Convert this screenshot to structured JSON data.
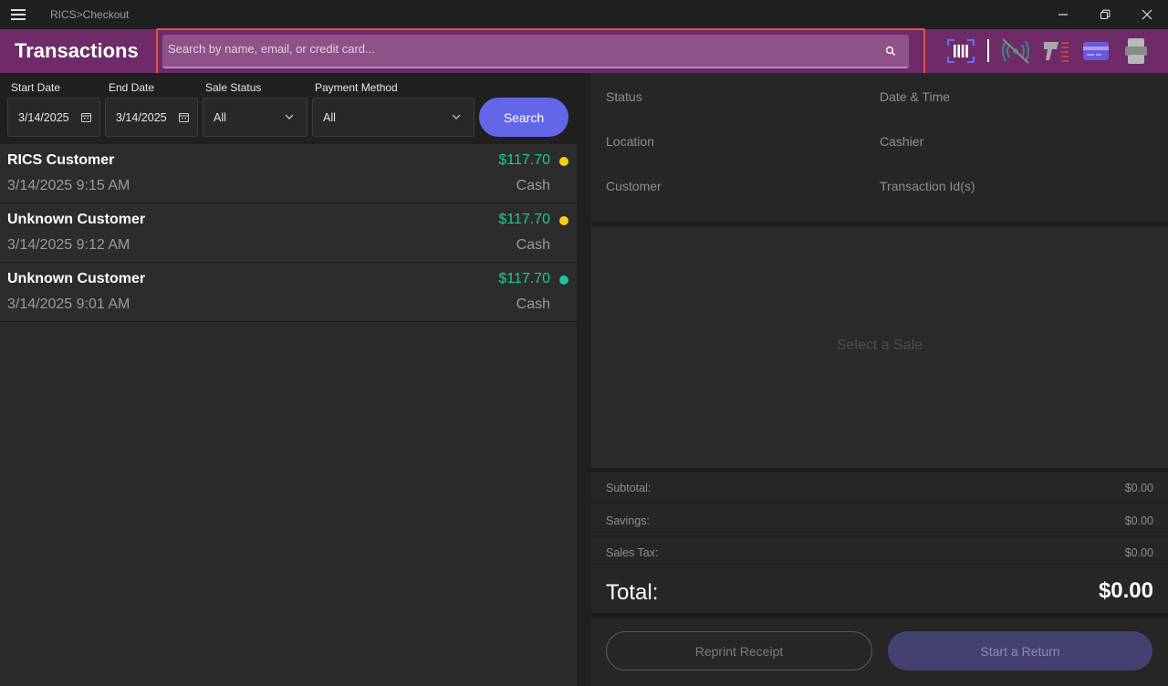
{
  "window": {
    "title": "RICS>Checkout",
    "minimize_icon": "minimize-icon",
    "restore_icon": "restore-icon",
    "close_icon": "close-icon"
  },
  "header": {
    "title": "Transactions",
    "search_placeholder": "Search by name, email, or credit card...",
    "search_value": "",
    "hardware_icons": [
      "barcode-scanner-icon",
      "nfc-disabled-icon",
      "handheld-scanner-icon",
      "card-reader-icon",
      "receipt-printer-icon"
    ]
  },
  "filters": {
    "start_date_label": "Start Date",
    "start_date": "3/14/2025",
    "end_date_label": "End Date",
    "end_date": "3/14/2025",
    "sale_status_label": "Sale Status",
    "sale_status": "All",
    "payment_method_label": "Payment Method",
    "payment_method": "All",
    "search_button": "Search"
  },
  "transactions": [
    {
      "name": "RICS Customer",
      "datetime": "3/14/2025 9:15 AM",
      "amount": "$117.70",
      "method": "Cash",
      "status_color": "#f5d016"
    },
    {
      "name": "Unknown Customer",
      "datetime": "3/14/2025 9:12 AM",
      "amount": "$117.70",
      "method": "Cash",
      "status_color": "#f5d016"
    },
    {
      "name": "Unknown Customer",
      "datetime": "3/14/2025 9:01 AM",
      "amount": "$117.70",
      "method": "Cash",
      "status_color": "#1fc49a"
    }
  ],
  "details": {
    "status_label": "Status",
    "datetime_label": "Date & Time",
    "location_label": "Location",
    "cashier_label": "Cashier",
    "customer_label": "Customer",
    "transaction_id_label": "Transaction Id(s)",
    "empty_message": "Select a Sale"
  },
  "totals": {
    "subtotal_label": "Subtotal:",
    "subtotal": "$0.00",
    "savings_label": "Savings:",
    "savings": "$0.00",
    "tax_label": "Sales Tax:",
    "tax": "$0.00",
    "total_label": "Total:",
    "total": "$0.00"
  },
  "actions": {
    "reprint": "Reprint Receipt",
    "start_return": "Start a Return"
  },
  "colors": {
    "header_bg": "#6e2b68",
    "accent": "#6366e6",
    "amount": "#22c49a",
    "search_highlight": "#e5504c"
  }
}
